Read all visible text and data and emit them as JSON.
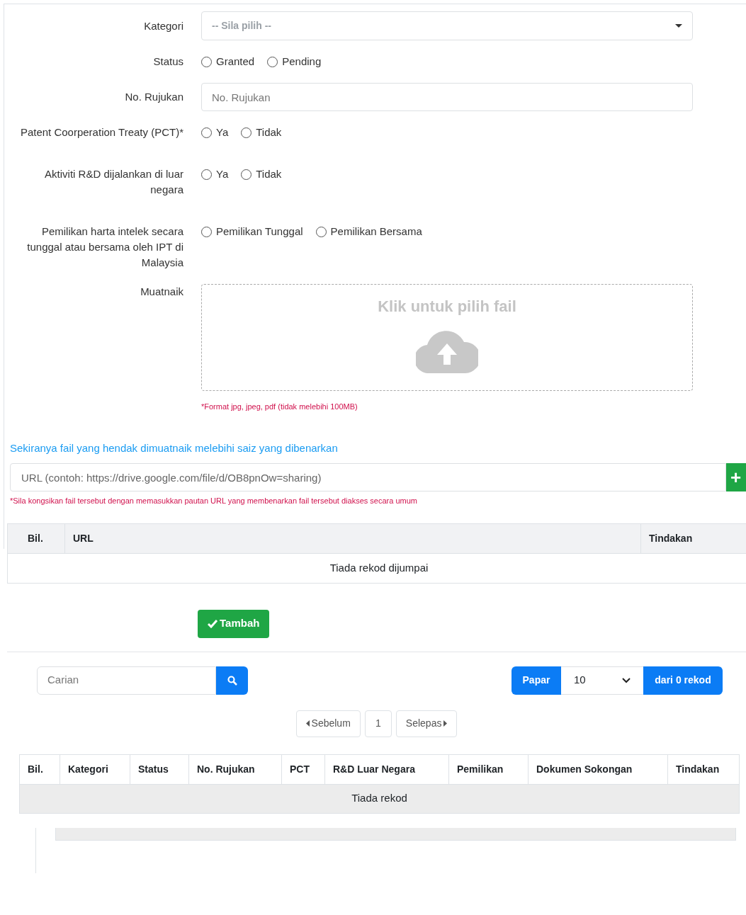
{
  "form": {
    "fields": [
      {
        "kind": "select",
        "label": "Kategori",
        "value": "-- Sila pilih --"
      },
      {
        "kind": "radio",
        "label": "Status",
        "options": [
          {
            "label": "Granted",
            "selected": false
          },
          {
            "label": "Pending",
            "selected": false
          }
        ]
      },
      {
        "kind": "text",
        "label": "No. Rujukan",
        "placeholder": "No. Rujukan"
      },
      {
        "kind": "radio",
        "label": "Patent Coorperation Treaty (PCT)*",
        "options": [
          {
            "label": "Ya",
            "selected": false
          },
          {
            "label": "Tidak",
            "selected": false
          }
        ]
      },
      {
        "kind": "radio",
        "label": "Aktiviti R&D dijalankan di luar negara",
        "options": [
          {
            "label": "Ya",
            "selected": false
          },
          {
            "label": "Tidak",
            "selected": false
          }
        ]
      },
      {
        "kind": "radio",
        "label": "Pemilikan harta intelek secara tunggal atau bersama oleh IPT di Malaysia",
        "options": [
          {
            "label": "Pemilikan Tunggal",
            "selected": false
          },
          {
            "label": "Pemilikan Bersama",
            "selected": false
          }
        ]
      },
      {
        "kind": "upload",
        "label": "Muatnaik",
        "prompt": "Klik untuk pilih fail",
        "note": "*Format jpg, jpeg, pdf (tidak melebihi 100MB)"
      }
    ]
  },
  "url_section": {
    "heading": "Sekiranya fail yang hendak dimuatnaik melebihi saiz yang dibenarkan",
    "placeholder": "URL (contoh: https://drive.google.com/file/d/OB8pnOw=sharing)",
    "add_button": "+",
    "note": "*Sila kongsikan fail tersebut dengan memasukkan pautan URL yang membenarkan fail tersebut diakses secara umum",
    "table": {
      "columns": [
        "Bil.",
        "URL",
        "Tindakan"
      ],
      "empty": "Tiada rekod dijumpai"
    }
  },
  "submit_button": "Tambah",
  "list": {
    "search_placeholder": "Carian",
    "show_label": "Papar",
    "page_size": "10",
    "count": "dari 0 rekod",
    "pagination": {
      "prev": "Sebelum",
      "pages": [
        {
          "label": "1",
          "selected": false
        }
      ],
      "next": "Selepas"
    },
    "table": {
      "columns": [
        "Bil.",
        "Kategori",
        "Status",
        "No. Rujukan",
        "PCT",
        "R&D Luar Negara",
        "Pemilikan",
        "Dokumen Sokongan",
        "Tindakan"
      ],
      "empty": "Tiada rekod"
    }
  }
}
